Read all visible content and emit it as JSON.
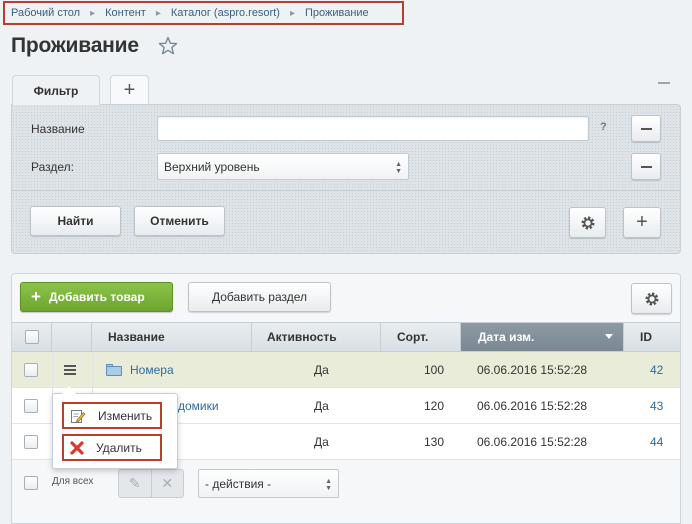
{
  "breadcrumb": {
    "items": [
      "Рабочий стол",
      "Контент",
      "Каталог (aspro.resort)",
      "Проживание"
    ],
    "separator": "▸"
  },
  "page": {
    "title": "Проживание"
  },
  "filter": {
    "tab_label": "Фильтр",
    "add_tab_label": "+",
    "fields": {
      "name_label": "Название",
      "name_value": "",
      "help_mark": "?",
      "section_label": "Раздел:",
      "section_value": "Верхний уровень"
    },
    "find_label": "Найти",
    "cancel_label": "Отменить",
    "add_label": "+"
  },
  "toolbar": {
    "add_product_label": "Добавить товар",
    "add_product_plus": "+",
    "add_section_label": "Добавить раздел",
    "accent_color": "#7cb43d"
  },
  "table": {
    "columns": [
      "Название",
      "Активность",
      "Сорт.",
      "Дата изм.",
      "ID"
    ],
    "rows": [
      {
        "name": "Номера",
        "active": "Да",
        "sort": "100",
        "date": "06.06.2016 15:52:28",
        "id": "42",
        "is_folder": true
      },
      {
        "name": "домики",
        "active": "Да",
        "sort": "120",
        "date": "06.06.2016 15:52:28",
        "id": "43",
        "is_folder": false
      },
      {
        "name": "",
        "active": "Да",
        "sort": "130",
        "date": "06.06.2016 15:52:28",
        "id": "44",
        "is_folder": false
      }
    ]
  },
  "context_menu": {
    "items": [
      {
        "label": "Изменить",
        "icon": "edit-icon"
      },
      {
        "label": "Удалить",
        "icon": "delete-icon"
      }
    ]
  },
  "footer": {
    "for_all_label": "Для всех",
    "edit_icon": "✎",
    "delete_icon": "✕",
    "actions_value": "- действия -"
  }
}
